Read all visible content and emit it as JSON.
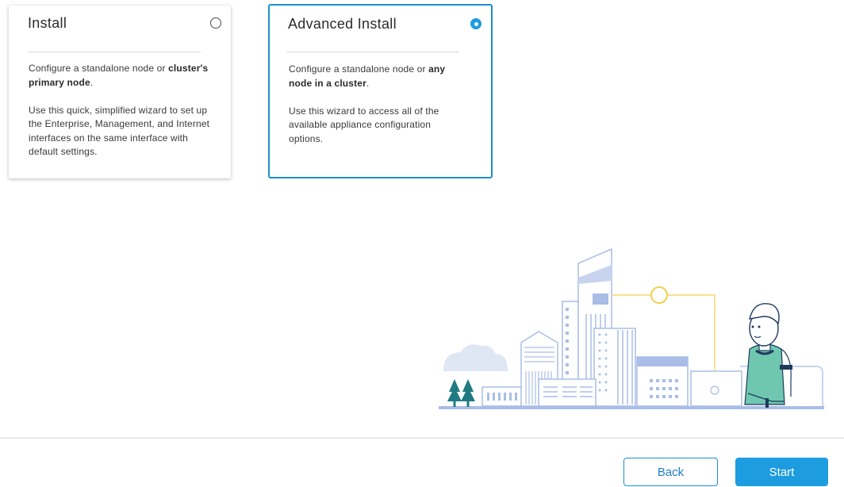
{
  "options": [
    {
      "title": "Install",
      "selected": false,
      "line1_pre": "Configure a standalone node or",
      "line1_bold": "cluster's primary node",
      "line1_post": ".",
      "paragraph2": "Use this quick, simplified wizard to set up the Enterprise, Management, and Internet interfaces on the same interface with default settings."
    },
    {
      "title": "Advanced Install",
      "selected": true,
      "line1_pre": "Configure a standalone node or",
      "line1_bold": "any node in a cluster",
      "line1_post": ".",
      "paragraph2": "Use this wizard to access all of the available appliance configuration options."
    }
  ],
  "footer": {
    "back_label": "Back",
    "start_label": "Start"
  },
  "colors": {
    "accent": "#1d9ce0",
    "accent_border": "#1d8ed1",
    "illustration_blue": "#a9bde6",
    "illustration_teal": "#1f7a82",
    "illustration_green": "#6fc7b0",
    "illustration_yellow": "#f2cf4a"
  },
  "icons": {
    "unselected_radio": "radio-unselected-icon",
    "selected_radio": "radio-selected-icon"
  }
}
